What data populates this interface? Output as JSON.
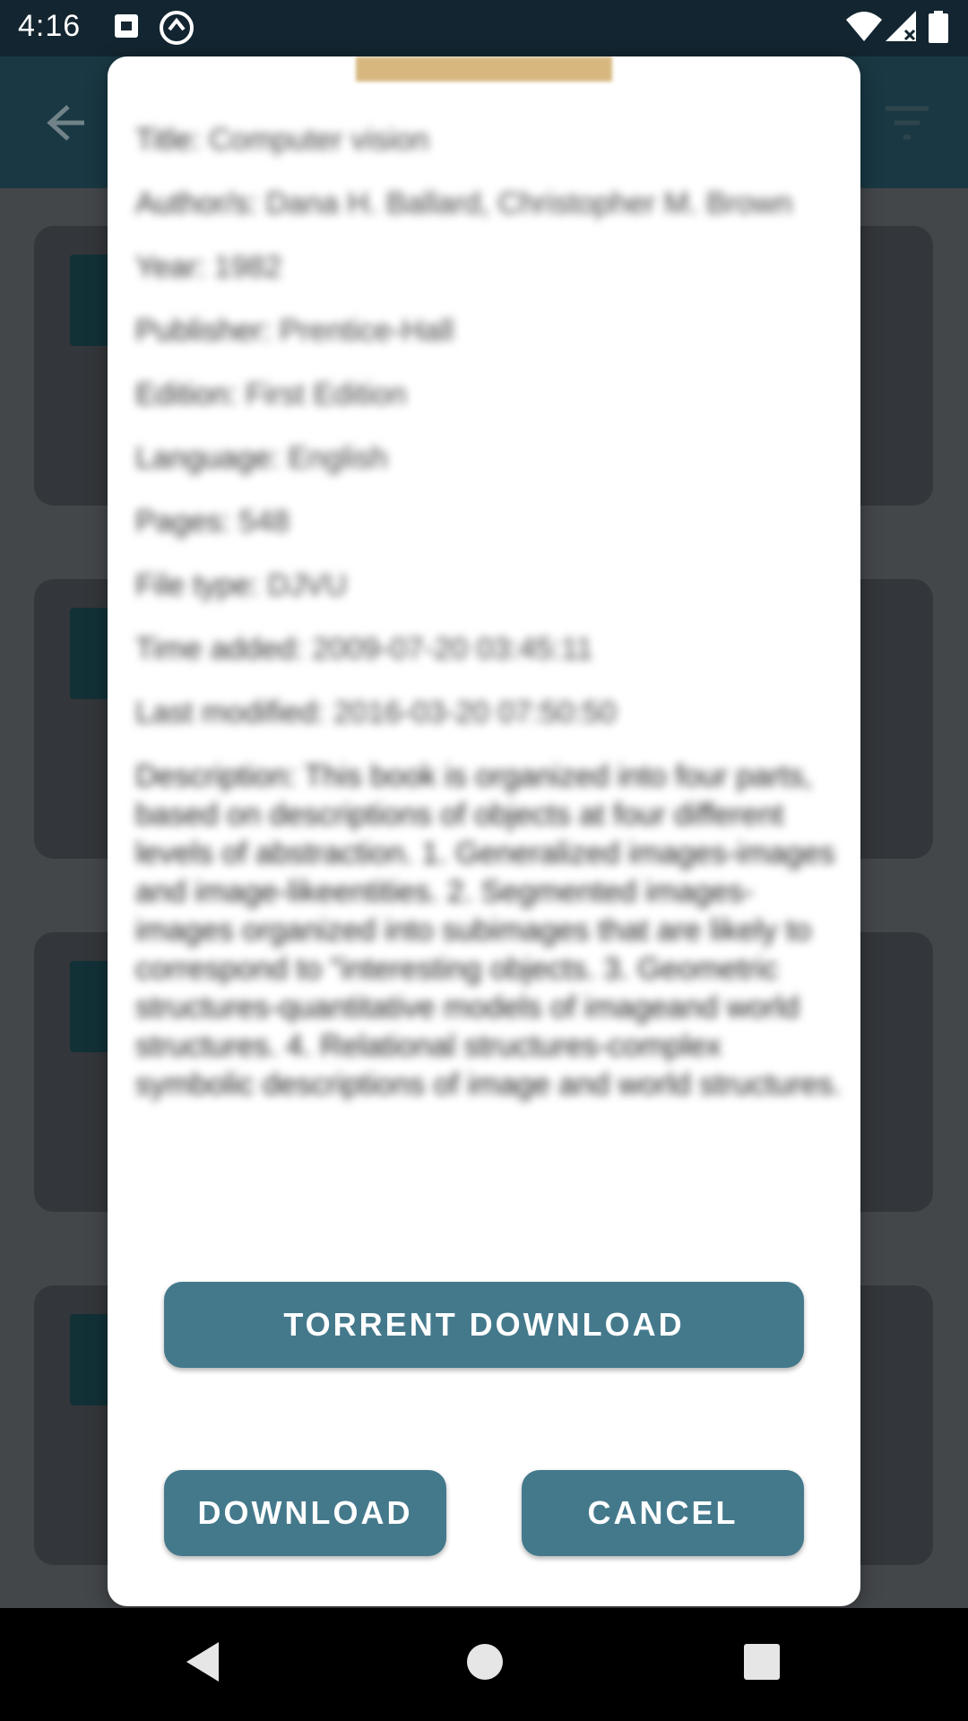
{
  "status_bar": {
    "time": "4:16",
    "icons": [
      "sim-card-icon",
      "sync-icon",
      "wifi-icon",
      "signal-icon",
      "battery-icon"
    ]
  },
  "app_bar": {
    "icons": [
      "back-arrow-icon",
      "filter-icon"
    ]
  },
  "dialog": {
    "fields": [
      {
        "key": "Title:",
        "value": "Computer vision"
      },
      {
        "key": "Author/s:",
        "value": "Dana H. Ballard, Christopher M. Brown"
      },
      {
        "key": "Year:",
        "value": "1982"
      },
      {
        "key": "Publisher:",
        "value": "Prentice-Hall"
      },
      {
        "key": "Edition:",
        "value": "First Edition"
      },
      {
        "key": "Language:",
        "value": "English"
      },
      {
        "key": "Pages:",
        "value": "548"
      },
      {
        "key": "File type:",
        "value": "DJVU"
      },
      {
        "key": "Time added:",
        "value": "2009-07-20 03:45:11"
      },
      {
        "key": "Last modified:",
        "value": "2016-03-20 07:50:50"
      }
    ],
    "description": "Description: This book is organized into four parts, based on descriptions of objects at four different levels of abstraction. 1. Generalized images-images and image-likeentities. 2. Segmented images-images organized into subimages that are likely to correspond to \"interesting objects. 3. Geometric structures-quantitative models of imageand world structures. 4. Relational structures-complex symbolic descriptions of image and world structures.",
    "torrent_button": "TORRENT DOWNLOAD",
    "download_button": "DOWNLOAD",
    "cancel_button": "CANCEL"
  },
  "colors": {
    "button": "#44798c",
    "status_bar": "#132530",
    "app_bar": "#1f4552",
    "cover_strip": "#d7b77e"
  }
}
